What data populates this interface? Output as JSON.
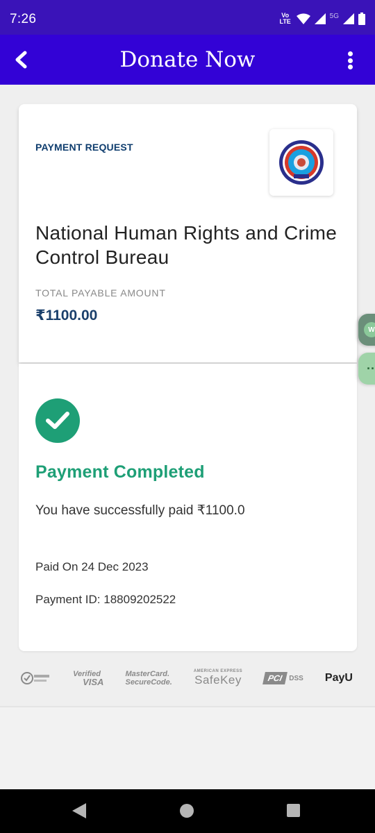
{
  "status_bar": {
    "time": "7:26",
    "volte": "Vo LTE",
    "network": "5G"
  },
  "app_bar": {
    "title": "Donate Now",
    "back_icon": "chevron-left-icon",
    "menu_icon": "more-vert-icon"
  },
  "request_card": {
    "label": "PAYMENT REQUEST",
    "org_name": "National Human Rights and Crime Control Bureau",
    "amount_label": "TOTAL PAYABLE AMOUNT",
    "amount": "₹1100.00"
  },
  "result_card": {
    "title": "Payment Completed",
    "message": "You have successfully paid ₹1100.0",
    "paid_on": "Paid On 24 Dec 2023",
    "payment_id": "Payment ID: 18809202522"
  },
  "trust_badges": {
    "verified_1": "Verified",
    "verified_2": "VISA",
    "mastercard_1": "MasterCard.",
    "mastercard_2": "SecureCode.",
    "amex_small": "AMERICAN EXPRESS",
    "safekey": "SafeKey",
    "pci": "PCI",
    "dss": "DSS",
    "payu": "PayU"
  },
  "colors": {
    "status_bar": "#3a13b8",
    "app_bar": "#3302d6",
    "success": "#1e9f76",
    "amount": "#1a3f6b"
  }
}
